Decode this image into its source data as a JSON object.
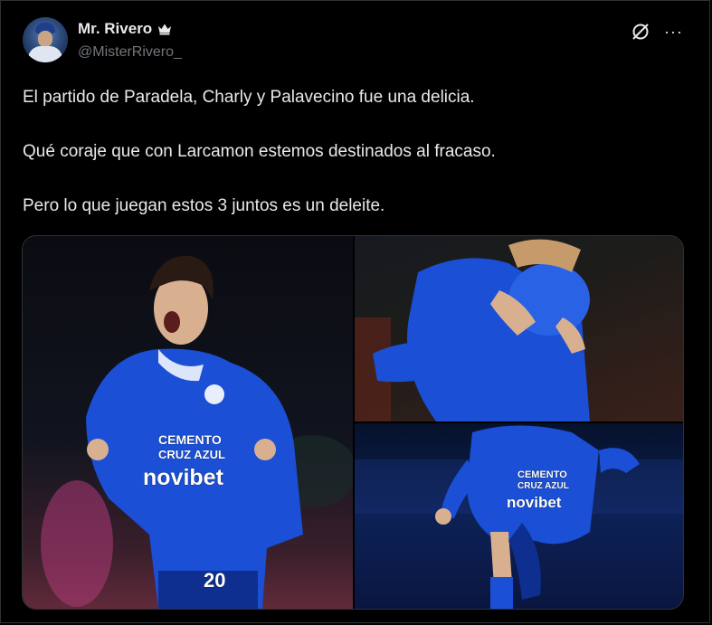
{
  "author": {
    "name": "Mr. Rivero",
    "handle": "@MisterRivero_",
    "badge_icon": "crown-icon"
  },
  "actions": {
    "grok_icon": "grok-icon",
    "more_label": "···"
  },
  "tweet": {
    "paragraphs": [
      "El partido de Paradela, Charly y Palavecino fue una delicia.",
      "Qué coraje que con Larcamon estemos destinados al fracaso.",
      "Pero lo que juegan estos 3 juntos es un deleite."
    ]
  },
  "media": {
    "left": {
      "sponsor": "CEMENTO",
      "sponsor2": "CRUZ AZUL",
      "brand": "novibet",
      "number": "20"
    },
    "bottom_right": {
      "sponsor": "CEMENTO",
      "sponsor2": "CRUZ AZUL",
      "brand": "novibet"
    }
  },
  "colors": {
    "background": "#000000",
    "text": "#e7e9ea",
    "secondary": "#71767b",
    "border": "#2f3336",
    "jersey": "#1a4fd6"
  }
}
